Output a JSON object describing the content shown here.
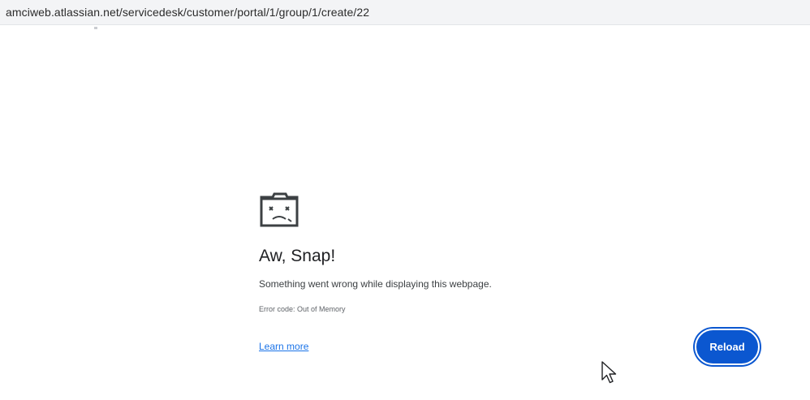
{
  "address_bar": {
    "url": "amciweb.atlassian.net/servicedesk/customer/portal/1/group/1/create/22"
  },
  "error_page": {
    "icon": "sad-tab-icon",
    "title": "Aw, Snap!",
    "message": "Something went wrong while displaying this webpage.",
    "error_code": "Error code: Out of Memory",
    "learn_more_label": "Learn more",
    "reload_label": "Reload"
  },
  "colors": {
    "accent": "#0b57d0",
    "link": "#1a73e8",
    "text": "#202124"
  },
  "cursor": {
    "icon": "mouse-pointer-icon"
  }
}
